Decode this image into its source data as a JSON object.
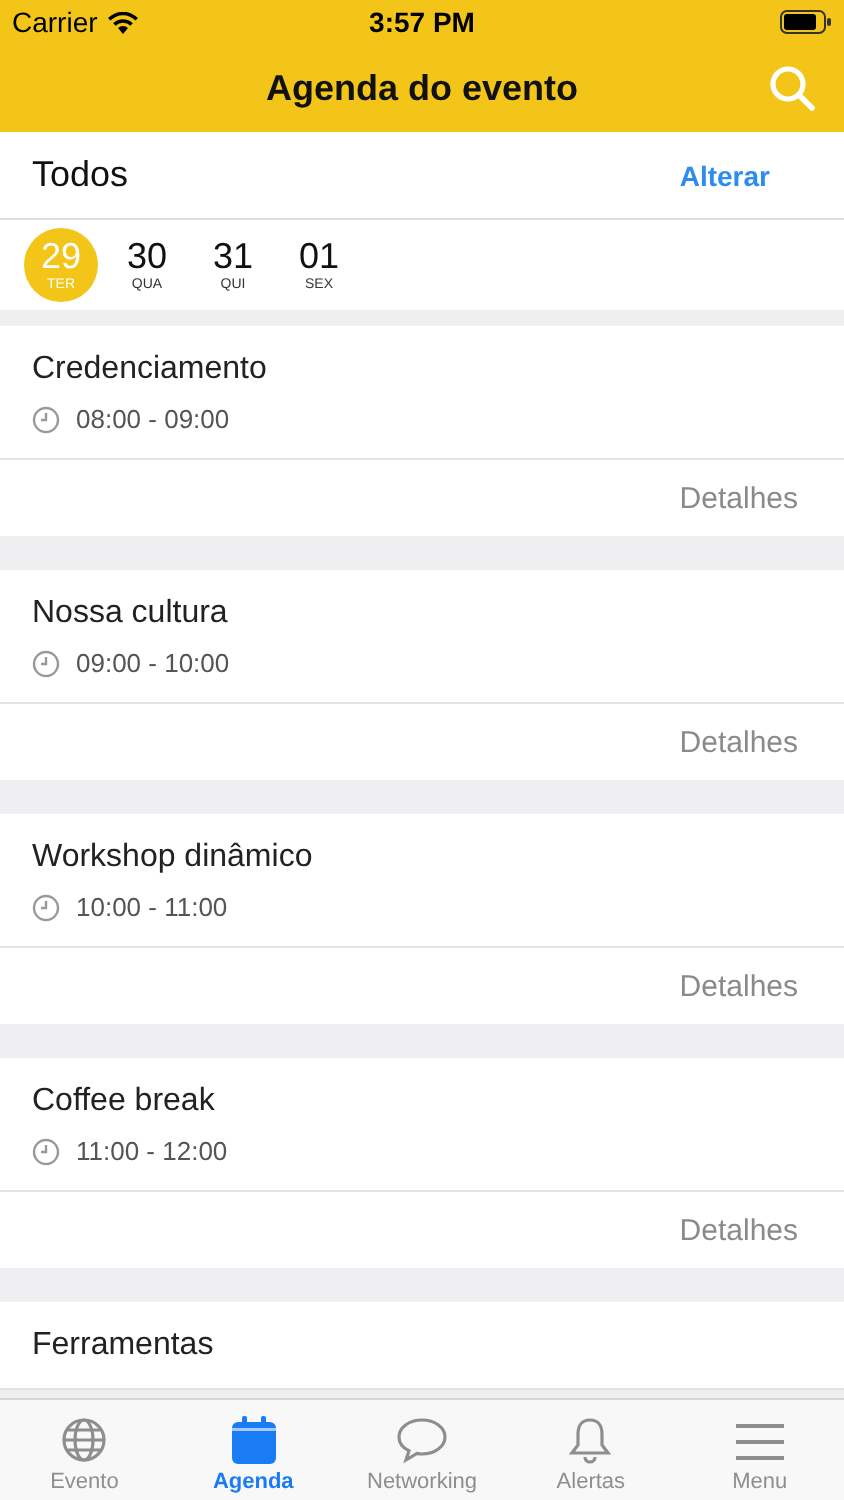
{
  "status_bar": {
    "carrier": "Carrier",
    "time": "3:57 PM"
  },
  "header": {
    "title": "Agenda do evento"
  },
  "filter": {
    "label": "Todos",
    "action": "Alterar"
  },
  "days": [
    {
      "number": "29",
      "weekday": "TER",
      "selected": true
    },
    {
      "number": "30",
      "weekday": "QUA",
      "selected": false
    },
    {
      "number": "31",
      "weekday": "QUI",
      "selected": false
    },
    {
      "number": "01",
      "weekday": "SEX",
      "selected": false
    }
  ],
  "sessions": [
    {
      "title": "Credenciamento",
      "time": "08:00 - 09:00",
      "link": "Detalhes"
    },
    {
      "title": "Nossa cultura",
      "time": "09:00 - 10:00",
      "link": "Detalhes"
    },
    {
      "title": "Workshop dinâmico",
      "time": "10:00 - 11:00",
      "link": "Detalhes"
    },
    {
      "title": "Coffee break",
      "time": "11:00 - 12:00",
      "link": "Detalhes"
    },
    {
      "title": "Ferramentas"
    }
  ],
  "tabs": [
    {
      "label": "Evento",
      "kind": "globe",
      "selected": false
    },
    {
      "label": "Agenda",
      "kind": "calendar",
      "selected": true
    },
    {
      "label": "Networking",
      "kind": "chat",
      "selected": false
    },
    {
      "label": "Alertas",
      "kind": "bell",
      "selected": false
    },
    {
      "label": "Menu",
      "kind": "menu",
      "selected": false
    }
  ]
}
